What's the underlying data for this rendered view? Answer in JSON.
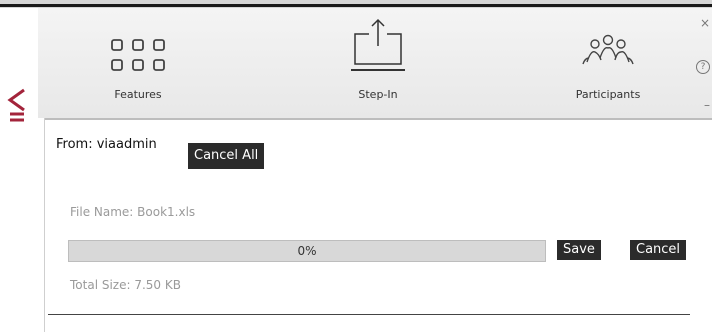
{
  "toolbar": {
    "features_label": "Features",
    "stepin_label": "Step-In",
    "participants_label": "Participants"
  },
  "window_controls": {
    "close_glyph": "×",
    "help_glyph": "?",
    "minimize_glyph": "–"
  },
  "transfer": {
    "from_text": "From: viaadmin",
    "cancel_all_label": "Cancel All",
    "file_name_text": "File Name: Book1.xls",
    "progress_text": "0%",
    "progress_value": 0,
    "save_label": "Save",
    "cancel_label": "Cancel",
    "total_size_text": "Total Size: 7.50 KB"
  },
  "icons": {
    "features": "grid-icon",
    "stepin": "step-in-icon",
    "participants": "participants-icon",
    "logo": "via-logo"
  },
  "colors": {
    "toolbar_bg": "#ececec",
    "dark_button": "#2b2b2b",
    "logo_red": "#a3243b",
    "muted_text": "#9a9a9a"
  }
}
